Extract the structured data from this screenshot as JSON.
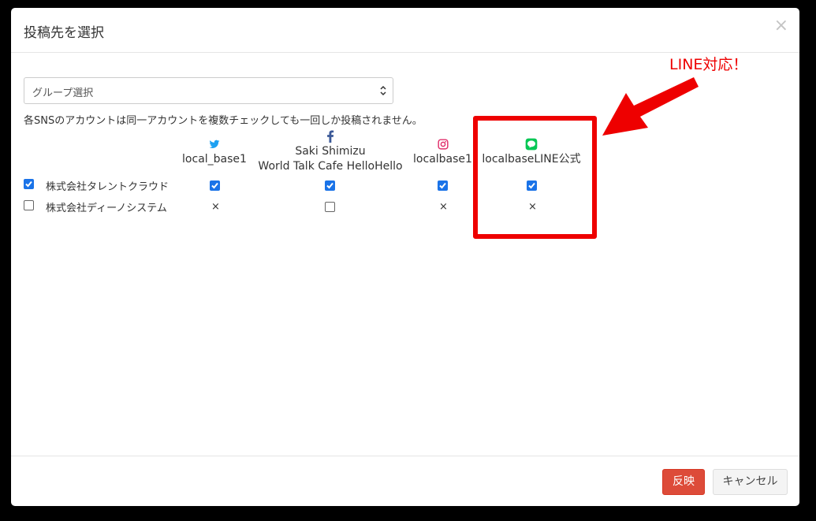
{
  "modal": {
    "title": "投稿先を選択",
    "close_label": "×"
  },
  "group_select": {
    "selected": "グループ選択"
  },
  "notice": "各SNSのアカウントは同一アカウントを複数チェックしても一回しか投稿されません。",
  "columns": [
    {
      "icon": "twitter-icon",
      "line1": "local_base1",
      "line2": ""
    },
    {
      "icon": "facebook-icon",
      "line1": "Saki Shimizu",
      "line2": "World Talk Cafe HelloHello"
    },
    {
      "icon": "instagram-icon",
      "line1": "localbase1",
      "line2": ""
    },
    {
      "icon": "line-icon",
      "line1": "localbaseLINE公式",
      "line2": ""
    }
  ],
  "rows": [
    {
      "label": "株式会社タレントクラウド",
      "checked": true,
      "cells": [
        "checked",
        "checked",
        "checked",
        "checked"
      ]
    },
    {
      "label": "株式会社ディーノシステム",
      "checked": false,
      "cells": [
        "×",
        "unchecked",
        "×",
        "×"
      ]
    }
  ],
  "footer": {
    "apply_label": "反映",
    "cancel_label": "キャンセル"
  },
  "annotation": {
    "text": "LINE対応！",
    "color": "#ee0000"
  },
  "colors": {
    "apply": "#dd4b39",
    "checkbox": "#1a73e8",
    "twitter": "#1da1f2",
    "facebook": "#3b5998",
    "instagram": "#e1306c",
    "line": "#06c755"
  }
}
